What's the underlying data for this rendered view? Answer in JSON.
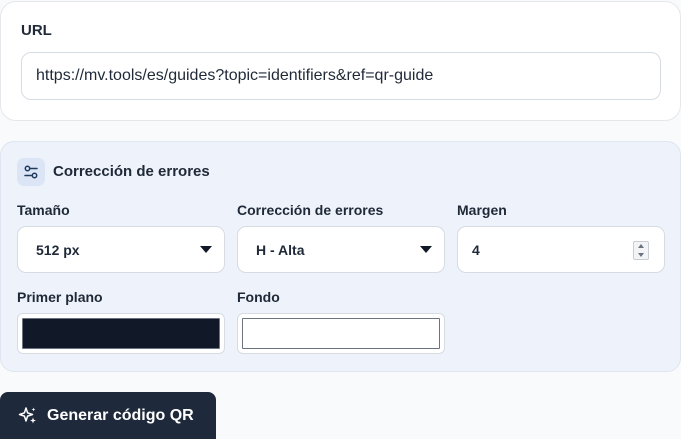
{
  "url_section": {
    "label": "URL",
    "value": "https://mv.tools/es/guides?topic=identifiers&ref=qr-guide"
  },
  "settings": {
    "title": "Corrección de errores",
    "icon": "sliders-icon",
    "size": {
      "label": "Tamaño",
      "selected": "512 px"
    },
    "error_correction": {
      "label": "Corrección de errores",
      "selected": "H - Alta"
    },
    "margin": {
      "label": "Margen",
      "value": "4"
    },
    "foreground": {
      "label": "Primer plano",
      "color": "#111827"
    },
    "background": {
      "label": "Fondo",
      "color": "#ffffff"
    }
  },
  "generate_button": {
    "label": "Generar código QR",
    "icon": "sparkles-icon"
  },
  "colors": {
    "accent": "#1e293b",
    "panel": "#eef2fb"
  }
}
